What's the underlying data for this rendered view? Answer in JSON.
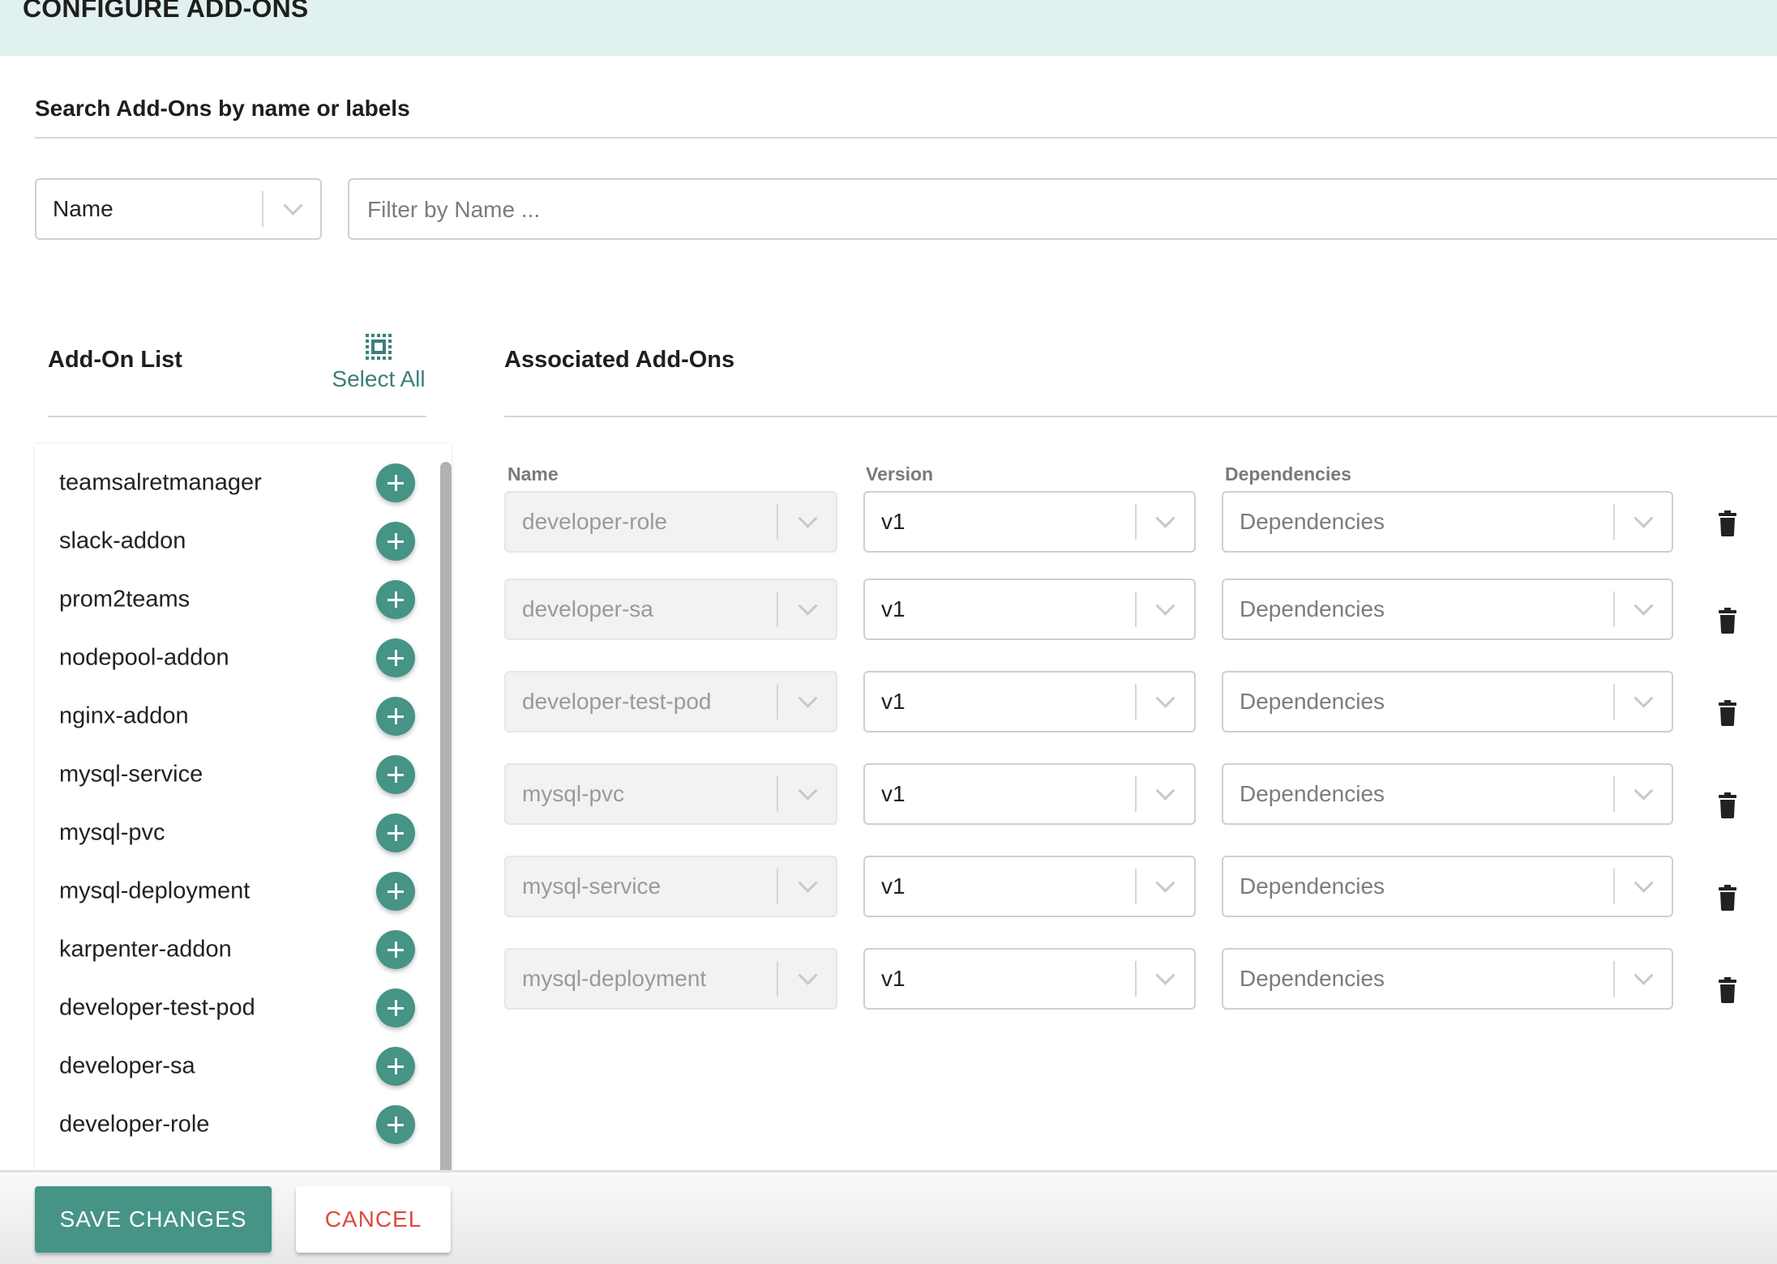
{
  "header": {
    "title": "CONFIGURE ADD-ONS"
  },
  "search": {
    "title": "Search Add-Ons by name or labels",
    "field_select": {
      "value": "Name"
    },
    "filter_placeholder": "Filter by Name ...",
    "filter_value": ""
  },
  "addon_list": {
    "title": "Add-On List",
    "select_all_label": "Select All",
    "select_all_icon": "select-all-icon",
    "add_icon": "plus-icon",
    "items": [
      {
        "label": "teamsalretmanager"
      },
      {
        "label": "slack-addon"
      },
      {
        "label": "prom2teams"
      },
      {
        "label": "nodepool-addon"
      },
      {
        "label": "nginx-addon"
      },
      {
        "label": "mysql-service"
      },
      {
        "label": "mysql-pvc"
      },
      {
        "label": "mysql-deployment"
      },
      {
        "label": "karpenter-addon"
      },
      {
        "label": "developer-test-pod"
      },
      {
        "label": "developer-sa"
      },
      {
        "label": "developer-role"
      }
    ]
  },
  "associated": {
    "title": "Associated Add-Ons",
    "columns": {
      "name": "Name",
      "version": "Version",
      "dependencies": "Dependencies"
    },
    "delete_icon": "trash-icon",
    "rows": [
      {
        "name": "developer-role",
        "version": "v1",
        "dependencies_placeholder": "Dependencies"
      },
      {
        "name": "developer-sa",
        "version": "v1",
        "dependencies_placeholder": "Dependencies"
      },
      {
        "name": "developer-test-pod",
        "version": "v1",
        "dependencies_placeholder": "Dependencies"
      },
      {
        "name": "mysql-pvc",
        "version": "v1",
        "dependencies_placeholder": "Dependencies"
      },
      {
        "name": "mysql-service",
        "version": "v1",
        "dependencies_placeholder": "Dependencies"
      },
      {
        "name": "mysql-deployment",
        "version": "v1",
        "dependencies_placeholder": "Dependencies"
      }
    ]
  },
  "footer": {
    "save_label": "SAVE CHANGES",
    "cancel_label": "CANCEL"
  },
  "colors": {
    "accent": "#459486",
    "header_bg": "#e1f1ef",
    "cancel_text": "#dc4b3e",
    "link": "#3b807b"
  }
}
